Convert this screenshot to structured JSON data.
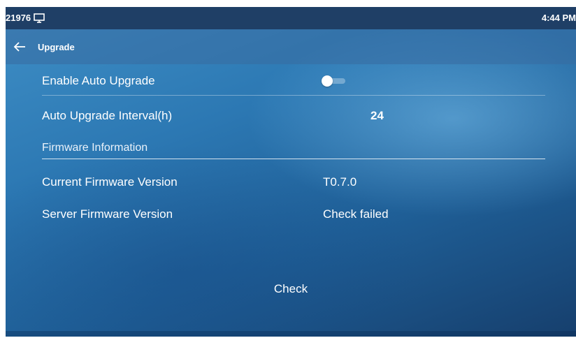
{
  "status_bar": {
    "extension": "21976",
    "time": "4:44 PM",
    "icon": "monitor-icon"
  },
  "header": {
    "back_icon": "arrow-left-icon",
    "title": "Upgrade"
  },
  "settings": {
    "auto_upgrade": {
      "label": "Enable Auto Upgrade",
      "enabled": false
    },
    "interval": {
      "label": "Auto Upgrade Interval(h)",
      "value": "24"
    }
  },
  "firmware": {
    "section_title": "Firmware Information",
    "current": {
      "label": "Current Firmware Version",
      "value": "T0.7.0"
    },
    "server": {
      "label": "Server Firmware Version",
      "value": "Check failed"
    }
  },
  "actions": {
    "check_label": "Check"
  },
  "colors": {
    "status_bar": "#1f3f66",
    "background": "#2c78b3",
    "text": "#ffffff"
  }
}
